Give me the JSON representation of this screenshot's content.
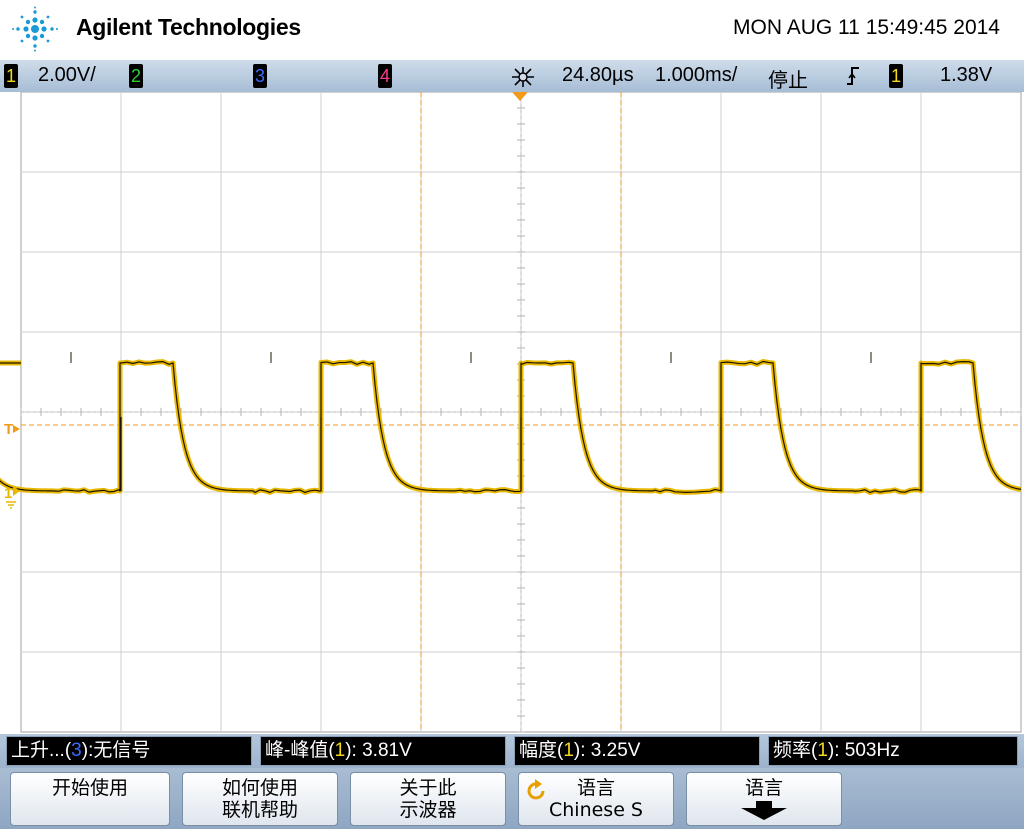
{
  "header": {
    "brand": "Agilent Technologies",
    "datetime": "MON AUG 11 15:49:45 2014"
  },
  "status": {
    "ch1": {
      "num": "1",
      "scale": "2.00V/",
      "color": "#f2d81e"
    },
    "ch2": {
      "num": "2",
      "color": "#2fd12f"
    },
    "ch3": {
      "num": "3",
      "color": "#3a6bff"
    },
    "ch4": {
      "num": "4",
      "color": "#ff3a8c"
    },
    "delay": "24.80µs",
    "timebase": "1.000ms/",
    "run_state": "停止",
    "trigger_source": "1",
    "trigger_level": "1.38V"
  },
  "measurements": [
    {
      "label": "上升...(",
      "ch": "3",
      "rest": "):无信号"
    },
    {
      "label": "峰-峰值(",
      "ch": "1",
      "rest": "): 3.81V"
    },
    {
      "label": "幅度(",
      "ch": "1",
      "rest": "): 3.25V"
    },
    {
      "label": "频率(",
      "ch": "1",
      "rest": "): 503Hz"
    }
  ],
  "softkeys": [
    {
      "line1": "开始使用",
      "line2": ""
    },
    {
      "line1": "如何使用",
      "line2": "联机帮助"
    },
    {
      "line1": "关于此",
      "line2": "示波器"
    },
    {
      "line1": "语言",
      "line2": "Chinese S"
    },
    {
      "line1": "语言",
      "line2": ""
    }
  ],
  "markers": {
    "trigger_label": "T",
    "ground_label": "1"
  },
  "colors": {
    "trace": "#f2c200",
    "cursor": "#f29a1a",
    "grid": "#c8c8c8"
  }
}
